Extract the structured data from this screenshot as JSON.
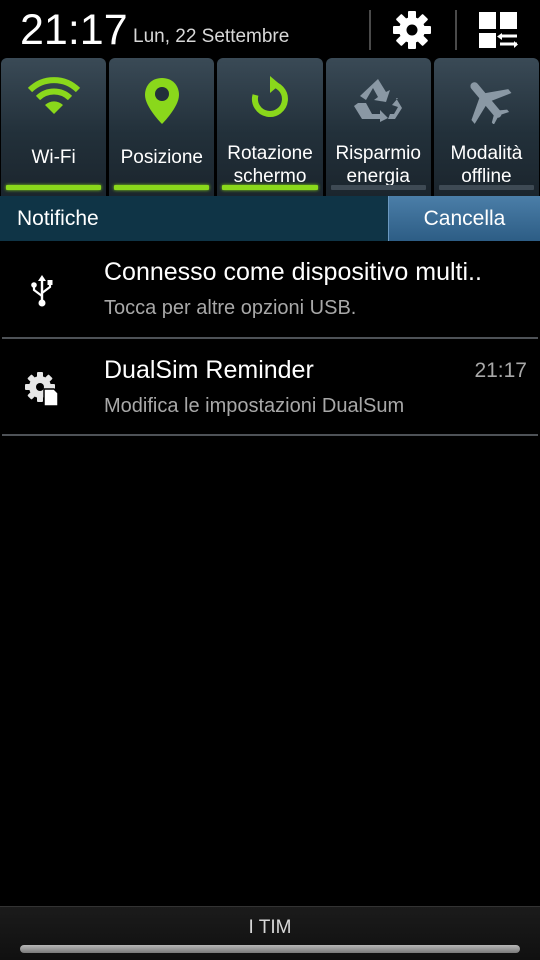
{
  "status": {
    "time": "21:17",
    "date": "Lun, 22 Settembre"
  },
  "header": {
    "settings_icon": "gear-icon",
    "multiwindow_icon": "multi-window-icon"
  },
  "quick_toggles": [
    {
      "label": "Wi-Fi",
      "icon": "wifi-icon",
      "state": "on"
    },
    {
      "label": "Posizione",
      "icon": "location-pin-icon",
      "state": "on"
    },
    {
      "label": "Rotazione schermo",
      "line1": "Rotazione",
      "line2": "schermo",
      "icon": "rotate-icon",
      "state": "on"
    },
    {
      "label": "Risparmio energia",
      "line1": "Risparmio",
      "line2": "energia",
      "icon": "recycle-icon",
      "state": "off"
    },
    {
      "label": "Modalità offline",
      "line1": "Modalità",
      "line2": "offline",
      "icon": "airplane-icon",
      "state": "off"
    }
  ],
  "notifications_header": {
    "title": "Notifiche",
    "clear_label": "Cancella"
  },
  "notifications": [
    {
      "icon": "usb-icon",
      "title": "Connesso come dispositivo multi..",
      "text": "Tocca per altre opzioni USB.",
      "time": ""
    },
    {
      "icon": "settings-app-icon",
      "title": "DualSim Reminder",
      "text": "Modifica le impostazioni DualSum",
      "time": "21:17"
    }
  ],
  "footer": {
    "carrier": "I TIM"
  },
  "colors": {
    "toggle_on": "#8ad81b",
    "toggle_off_icon": "#8a98a4",
    "notif_bar": "#0f3446",
    "clear_button": "#3d6e97"
  }
}
